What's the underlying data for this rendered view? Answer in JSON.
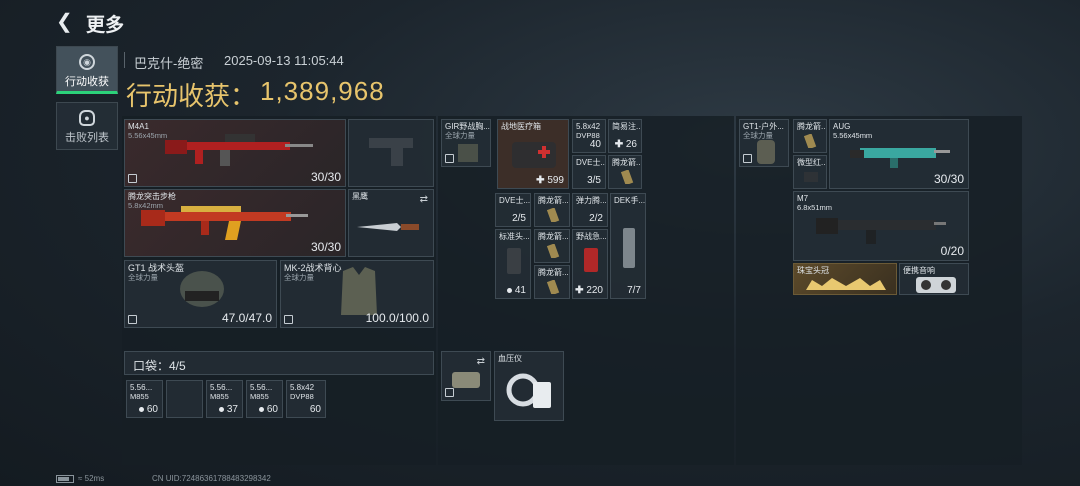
{
  "header": {
    "back_icon": "back-chevron-icon",
    "title": "更多"
  },
  "nav": {
    "loot": {
      "label": "行动收获",
      "icon": "loot-icon"
    },
    "kills": {
      "label": "击败列表",
      "icon": "skull-icon"
    }
  },
  "info": {
    "map": "巴克什-绝密",
    "datetime": "2025-09-13 11:05:44",
    "loot_label": "行动收获：",
    "loot_value": "1,389,968"
  },
  "gear": {
    "primary": {
      "name": "M4A1",
      "sub": "5.56x45mm",
      "ammo": "30/30"
    },
    "secondary": {
      "name": "腾龙突击步枪",
      "sub": "5.8x42mm",
      "ammo": "30/30"
    },
    "melee": {
      "name": "黑鹰"
    },
    "helmet": {
      "name": "GT1 战术头盔",
      "sub": "全球力量",
      "durability": "47.0/47.0"
    },
    "armor": {
      "name": "MK-2战术背心",
      "sub": "全球力量",
      "durability": "100.0/100.0"
    }
  },
  "pockets": {
    "label": "口袋：4/5",
    "items": [
      {
        "name": "5.56...",
        "sub": "M855",
        "count": "60"
      },
      {
        "name": "",
        "sub": "",
        "count": ""
      },
      {
        "name": "5.56...",
        "sub": "M855",
        "count": "37"
      },
      {
        "name": "5.56...",
        "sub": "M855",
        "count": "60"
      },
      {
        "name": "5.8x42",
        "sub": "DVP88",
        "count": "60"
      }
    ]
  },
  "rig": {
    "name": "GIR野战胸...",
    "sub": "全球力量",
    "items": {
      "medkit": {
        "name": "战地医疗箱",
        "count": "599"
      },
      "ammo_dvp": {
        "name": "5.8x42",
        "sub": "DVP88",
        "count": "40"
      },
      "ammo_simple": {
        "name": "简易注...",
        "count": "26"
      },
      "dve1": {
        "name": "DVE士...",
        "count": "3/5"
      },
      "tenglong1": {
        "name": "腾龙箭..."
      },
      "dve2": {
        "name": "DVE士...",
        "count": "2/5"
      },
      "tenglong2": {
        "name": "腾龙箭..."
      },
      "tenglong_ammo": {
        "name": "弹力腾...",
        "count": "2/2"
      },
      "dek": {
        "name": "DEK手...",
        "count": "7/7"
      },
      "std_head": {
        "name": "标准头...",
        "count": "41"
      },
      "tenglong3": {
        "name": "腾龙箭..."
      },
      "field_aid": {
        "name": "野战急...",
        "count": "220"
      },
      "tenglong4": {
        "name": "腾龙箭..."
      }
    }
  },
  "bag_extra": {
    "name": "血压仪"
  },
  "backpack": {
    "name": "GT1-户外...",
    "sub": "全球力量",
    "items": {
      "tenglong": {
        "name": "腾龙箭..."
      },
      "aug": {
        "name": "AUG",
        "sub": "5.56x45mm",
        "ammo": "30/30"
      },
      "micro": {
        "name": "微型红..."
      },
      "m7": {
        "name": "M7",
        "sub": "6.8x51mm",
        "ammo": "0/20"
      },
      "crown": {
        "name": "珠宝头冠"
      },
      "speaker": {
        "name": "便携音响"
      }
    }
  },
  "footer": {
    "ping": "52ms",
    "uid": "CN UID:7248636178848329834​2"
  },
  "colors": {
    "accent_gold": "#e7c46c",
    "active_green": "#2cd27a"
  }
}
